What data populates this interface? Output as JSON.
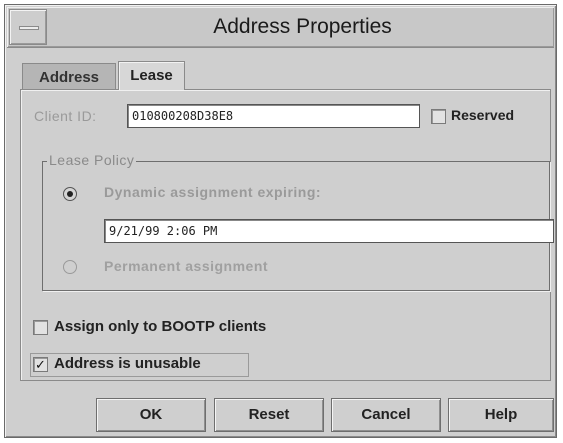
{
  "window": {
    "title": "Address Properties"
  },
  "tabs": [
    {
      "label": "Address",
      "active": false
    },
    {
      "label": "Lease",
      "active": true
    }
  ],
  "client_id": {
    "label": "Client ID:",
    "value": "010800208D38E8"
  },
  "reserved": {
    "label": "Reserved",
    "checked": false
  },
  "lease_policy": {
    "title": "Lease Policy",
    "dynamic_label": "Dynamic assignment expiring:",
    "dynamic_selected": true,
    "expiry_value": "9/21/99 2:06 PM",
    "permanent_label": "Permanent assignment",
    "permanent_selected": false
  },
  "bootp_only": {
    "label": "Assign only to BOOTP clients",
    "checked": false
  },
  "unusable": {
    "label": "Address is unusable",
    "checked": true,
    "check_mark": "✓"
  },
  "buttons": {
    "ok": "OK",
    "reset": "Reset",
    "cancel": "Cancel",
    "help": "Help"
  }
}
